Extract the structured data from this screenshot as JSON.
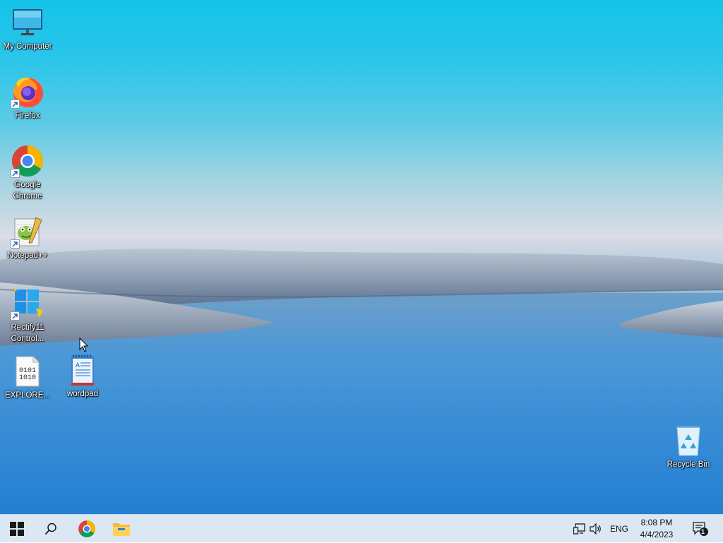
{
  "desktop_icons": [
    {
      "name": "my-computer",
      "label": "My Computer",
      "shortcut": false
    },
    {
      "name": "firefox",
      "label": "Firefox",
      "shortcut": true
    },
    {
      "name": "google-chrome",
      "label": "Google Chrome",
      "shortcut": true
    },
    {
      "name": "notepad-plus-plus",
      "label": "Notepad++",
      "shortcut": true
    },
    {
      "name": "rectify11-control",
      "label": "Rectify11 Control...",
      "shortcut": true
    },
    {
      "name": "explorer-file",
      "label": "EXPLORE...",
      "shortcut": false
    },
    {
      "name": "wordpad",
      "label": "wordpad",
      "shortcut": false
    },
    {
      "name": "recycle-bin",
      "label": "Recycle Bin",
      "shortcut": false
    }
  ],
  "explorer_file_glyph": {
    "line1": "0101",
    "line2": "1010"
  },
  "taskbar": {
    "buttons": [
      "start-icon",
      "search-icon",
      "chrome-icon",
      "file-explorer-icon"
    ],
    "tray": {
      "language": "ENG",
      "time": "8:08 PM",
      "date": "4/4/2023",
      "notification_count": "1"
    },
    "icons": [
      "network-icon",
      "volume-icon",
      "notification-icon"
    ]
  },
  "colors": {
    "taskbar_bg": "#dbe8f3",
    "label_text": "#ffffff"
  }
}
